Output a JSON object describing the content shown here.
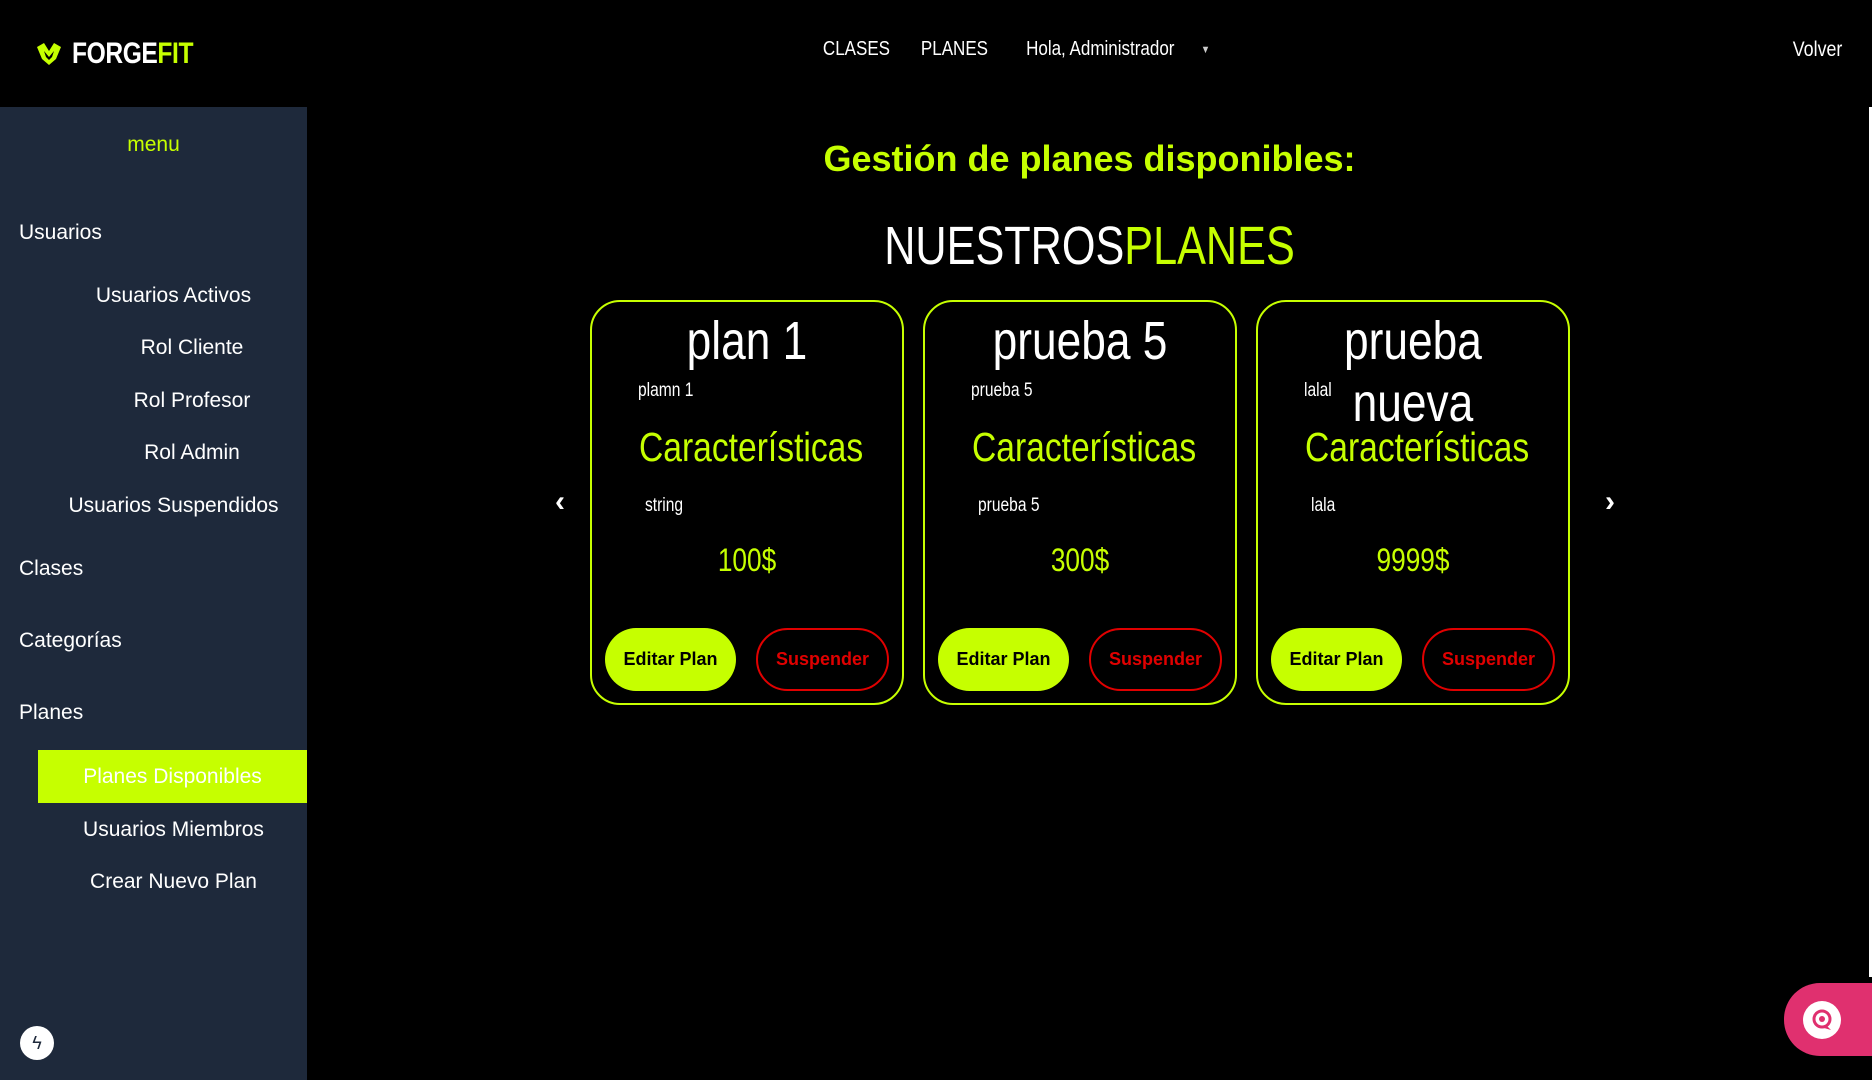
{
  "header": {
    "logo_part1": "FORGE",
    "logo_part2": "FIT",
    "nav": [
      "CLASES",
      "PLANES",
      "Hola, Administrador"
    ],
    "back_label": "Volver"
  },
  "sidebar": {
    "title": "menu",
    "usuarios": "Usuarios",
    "usuarios_items": [
      "Usuarios Activos",
      "Rol Cliente",
      "Rol Profesor",
      "Rol Admin",
      "Usuarios Suspendidos"
    ],
    "clases": "Clases",
    "categorias": "Categorías",
    "planes": "Planes",
    "planes_items": [
      "Planes Disponibles",
      "Usuarios Miembros",
      "Crear Nuevo Plan"
    ],
    "active_item": "Planes Disponibles"
  },
  "main": {
    "heading": "Gestión de planes disponibles:",
    "section_title_1": "NUESTROS",
    "section_title_2": "PLANES",
    "prev_arrow": "‹",
    "next_arrow": "›"
  },
  "plans": [
    {
      "name": "plan 1",
      "description": "plamn 1",
      "features_title": "Características",
      "features": "string",
      "price": "100$",
      "edit_label": "Editar Plan",
      "suspend_label": "Suspender"
    },
    {
      "name": "prueba 5",
      "description": "prueba 5",
      "features_title": "Características",
      "features": "prueba 5",
      "price": "300$",
      "edit_label": "Editar Plan",
      "suspend_label": "Suspender"
    },
    {
      "name": "prueba nueva",
      "description": "lalal",
      "features_title": "Características",
      "features": "lala",
      "price": "9999$",
      "edit_label": "Editar Plan",
      "suspend_label": "Suspender"
    }
  ],
  "colors": {
    "accent": "#c6ff00",
    "sidebar_bg": "#1e293b",
    "danger": "#e00000",
    "chat": "#e0306f"
  },
  "icons": {
    "logo": "forgefit-logo-icon",
    "bolt": "bolt-icon",
    "chat": "chat-support-icon"
  }
}
